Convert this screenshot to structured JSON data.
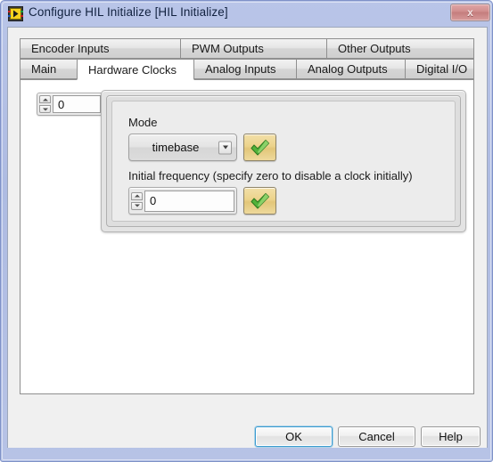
{
  "window": {
    "title": "Configure HIL Initialize [HIL Initialize]",
    "icon": "labview-vi-icon",
    "close_label": "x",
    "titlebar_color": "#b2bfe4",
    "client_color": "#f0f0f0"
  },
  "tabs": {
    "top_row": [
      {
        "label": "Encoder Inputs",
        "selected": false
      },
      {
        "label": "PWM Outputs",
        "selected": false
      },
      {
        "label": "Other Outputs",
        "selected": false
      }
    ],
    "bottom_row": [
      {
        "label": "Main",
        "selected": false
      },
      {
        "label": "Hardware Clocks",
        "selected": true
      },
      {
        "label": "Analog Inputs",
        "selected": false
      },
      {
        "label": "Analog Outputs",
        "selected": false
      },
      {
        "label": "Digital I/O",
        "selected": false
      }
    ]
  },
  "panel": {
    "index_control": {
      "name": "clock-index",
      "value": "0",
      "spinner_up": "increment",
      "spinner_down": "decrement"
    },
    "mode": {
      "label": "Mode",
      "value": "timebase",
      "dropdown_icon": "chevron-down-icon",
      "confirm_icon": "green-check-icon"
    },
    "initial_frequency": {
      "label": "Initial frequency (specify zero to disable a clock initially)",
      "value": "0",
      "confirm_icon": "green-check-icon"
    }
  },
  "footer": {
    "ok_label": "OK",
    "cancel_label": "Cancel",
    "help_label": "Help",
    "default_accent": "#3c9bd0"
  }
}
